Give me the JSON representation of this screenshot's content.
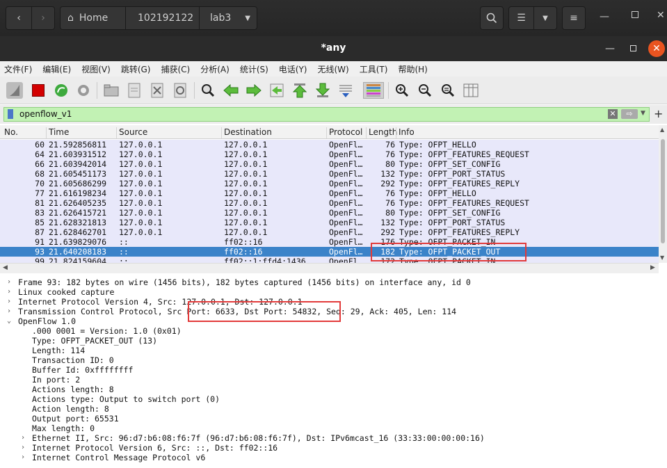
{
  "files": {
    "path": [
      "Home",
      "102192122",
      "lab3"
    ]
  },
  "window": {
    "title": "*any"
  },
  "menu": [
    "文件(F)",
    "编辑(E)",
    "视图(V)",
    "跳转(G)",
    "捕获(C)",
    "分析(A)",
    "统计(S)",
    "电话(Y)",
    "无线(W)",
    "工具(T)",
    "帮助(H)"
  ],
  "filter": {
    "value": "openflow_v1"
  },
  "columns": [
    "No.",
    "Time",
    "Source",
    "Destination",
    "Protocol",
    "Length",
    "Info"
  ],
  "packets": [
    [
      "60",
      "21.592856811",
      "127.0.0.1",
      "127.0.0.1",
      "OpenFl…",
      "76",
      "Type: OFPT_HELLO"
    ],
    [
      "64",
      "21.603931512",
      "127.0.0.1",
      "127.0.0.1",
      "OpenFl…",
      "76",
      "Type: OFPT_FEATURES_REQUEST"
    ],
    [
      "66",
      "21.603942014",
      "127.0.0.1",
      "127.0.0.1",
      "OpenFl…",
      "80",
      "Type: OFPT_SET_CONFIG"
    ],
    [
      "68",
      "21.605451173",
      "127.0.0.1",
      "127.0.0.1",
      "OpenFl…",
      "132",
      "Type: OFPT_PORT_STATUS"
    ],
    [
      "70",
      "21.605686299",
      "127.0.0.1",
      "127.0.0.1",
      "OpenFl…",
      "292",
      "Type: OFPT_FEATURES_REPLY"
    ],
    [
      "77",
      "21.616198234",
      "127.0.0.1",
      "127.0.0.1",
      "OpenFl…",
      "76",
      "Type: OFPT_HELLO"
    ],
    [
      "81",
      "21.626405235",
      "127.0.0.1",
      "127.0.0.1",
      "OpenFl…",
      "76",
      "Type: OFPT_FEATURES_REQUEST"
    ],
    [
      "83",
      "21.626415721",
      "127.0.0.1",
      "127.0.0.1",
      "OpenFl…",
      "80",
      "Type: OFPT_SET_CONFIG"
    ],
    [
      "85",
      "21.628321813",
      "127.0.0.1",
      "127.0.0.1",
      "OpenFl…",
      "132",
      "Type: OFPT_PORT_STATUS"
    ],
    [
      "87",
      "21.628462701",
      "127.0.0.1",
      "127.0.0.1",
      "OpenFl…",
      "292",
      "Type: OFPT_FEATURES_REPLY"
    ],
    [
      "91",
      "21.639829076",
      "::",
      "ff02::16",
      "OpenFl…",
      "176",
      "Type: OFPT_PACKET_IN"
    ],
    [
      "93",
      "21.640208183",
      "::",
      "ff02::16",
      "OpenFl…",
      "182",
      "Type: OFPT_PACKET_OUT"
    ],
    [
      "99",
      "21.824159604",
      "::",
      "ff02::1:ffd4:1436",
      "OpenFl…",
      "172",
      "Type: OFPT_PACKET_IN"
    ]
  ],
  "selected_index": 11,
  "details": [
    {
      "text": "Frame 93: 182 bytes on wire (1456 bits), 182 bytes captured (1456 bits) on interface any, id 0",
      "indent": 0,
      "arrow": "›"
    },
    {
      "text": "Linux cooked capture",
      "indent": 0,
      "arrow": "›"
    },
    {
      "text": "Internet Protocol Version 4, Src: 127.0.0.1, Dst: 127.0.0.1",
      "indent": 0,
      "arrow": "›"
    },
    {
      "text": "Transmission Control Protocol, Src Port: 6633, Dst Port: 54832, Seq: 29, Ack: 405, Len: 114",
      "indent": 0,
      "arrow": "›"
    },
    {
      "text": "OpenFlow 1.0",
      "indent": 0,
      "arrow": "⌄"
    },
    {
      "text": ".000 0001 = Version: 1.0 (0x01)",
      "indent": 1,
      "arrow": ""
    },
    {
      "text": "Type: OFPT_PACKET_OUT (13)",
      "indent": 1,
      "arrow": ""
    },
    {
      "text": "Length: 114",
      "indent": 1,
      "arrow": ""
    },
    {
      "text": "Transaction ID: 0",
      "indent": 1,
      "arrow": ""
    },
    {
      "text": "Buffer Id: 0xffffffff",
      "indent": 1,
      "arrow": ""
    },
    {
      "text": "In port: 2",
      "indent": 1,
      "arrow": ""
    },
    {
      "text": "Actions length: 8",
      "indent": 1,
      "arrow": ""
    },
    {
      "text": "Actions type: Output to switch port (0)",
      "indent": 1,
      "arrow": ""
    },
    {
      "text": "Action length: 8",
      "indent": 1,
      "arrow": ""
    },
    {
      "text": "Output port: 65531",
      "indent": 1,
      "arrow": ""
    },
    {
      "text": "Max length: 0",
      "indent": 1,
      "arrow": ""
    },
    {
      "text": "Ethernet II, Src: 96:d7:b6:08:f6:7f (96:d7:b6:08:f6:7f), Dst: IPv6mcast_16 (33:33:00:00:00:16)",
      "indent": 1,
      "arrow": "›"
    },
    {
      "text": "Internet Protocol Version 6, Src: ::, Dst: ff02::16",
      "indent": 1,
      "arrow": "›"
    },
    {
      "text": "Internet Control Message Protocol v6",
      "indent": 1,
      "arrow": "›"
    }
  ],
  "colors": {
    "filter_bg": "#c2f2b4",
    "row_bg": "#e8e8fa",
    "selected_bg": "#3b83c9",
    "highlight_box": "#e23a3a"
  }
}
